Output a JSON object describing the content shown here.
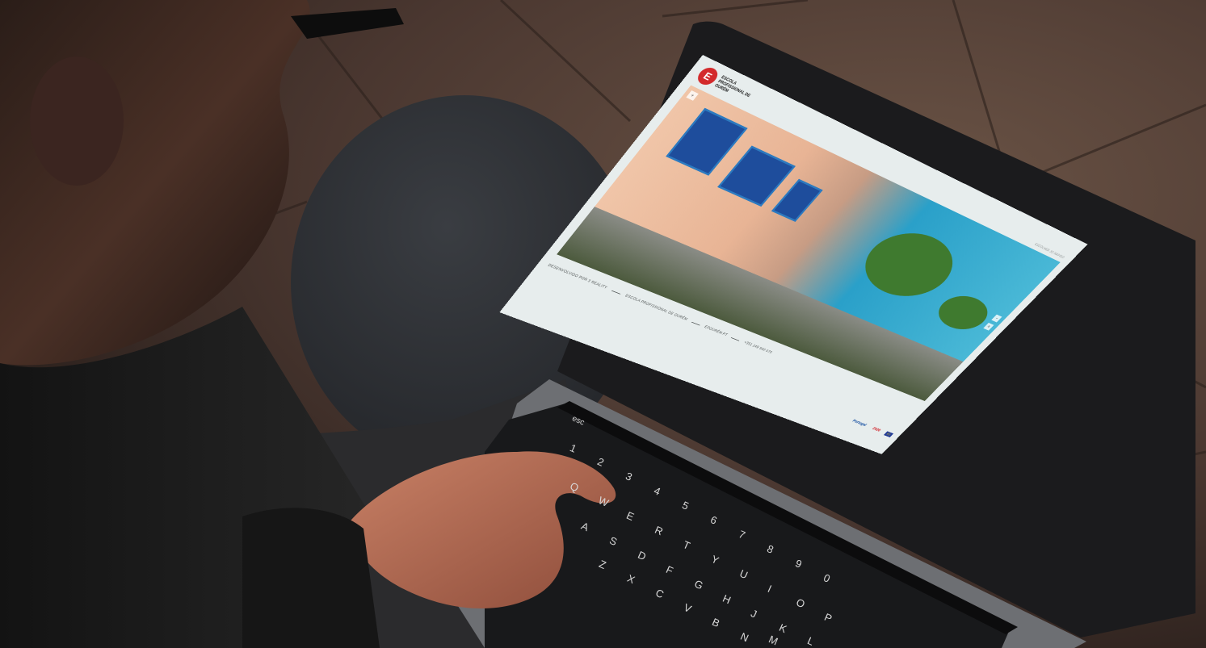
{
  "website": {
    "logo": {
      "mark": "E",
      "text": "ESCOLA PROFISSIONAL DE OURÉM"
    },
    "top_right_label": "ESCOLHER 3D RÁPIDO",
    "hero_controls": [
      "+",
      "−",
      "≡"
    ],
    "footer": [
      "DESENVOLVIDO POR 3 REALITY",
      "ESCOLA PROFISSIONAL DE OURÉM",
      "EPOURÉM.PT",
      "+351 249 540 070"
    ],
    "partners": [
      "Portugal",
      "2020",
      "EU"
    ]
  },
  "keyboard": {
    "esc_label": "esc",
    "keys": [
      "1",
      "2",
      "3",
      "4",
      "5",
      "6",
      "7",
      "8",
      "9",
      "0",
      "Q",
      "W",
      "E",
      "R",
      "T",
      "Y",
      "U",
      "I",
      "O",
      "P",
      "A",
      "S",
      "D",
      "F",
      "G",
      "H",
      "J",
      "K",
      "L",
      "Z",
      "X",
      "C",
      "V",
      "B",
      "N",
      "M"
    ]
  }
}
